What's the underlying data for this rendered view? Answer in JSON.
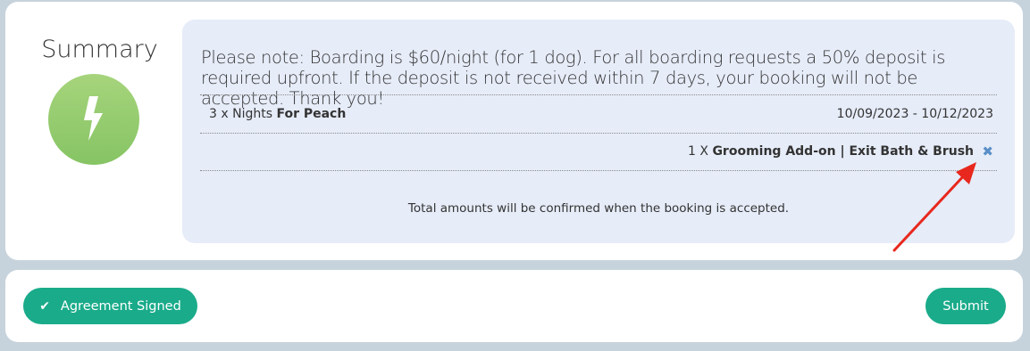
{
  "summary": {
    "title": "Summary",
    "icon": "lightning-bolt-icon",
    "icon_color": "#95cc6f"
  },
  "booking": {
    "note": "Please note: Boarding is $60/night (for 1 dog). For all boarding requests a 50% deposit is required upfront. If the deposit is not received within 7 days, your booking will not be accepted. Thank you!",
    "nights_prefix": "3 x Nights",
    "pet_label": "For Peach",
    "dates": "10/09/2023 - 10/12/2023",
    "addon_prefix": "1 X",
    "addon_name": "Grooming Add-on | Exit Bath & Brush",
    "remove_icon": "close-icon",
    "total_note": "Total amounts will be confirmed when the booking is accepted."
  },
  "footer": {
    "agreement_label": "Agreement Signed",
    "agreement_icon": "checkmark-icon",
    "submit_label": "Submit",
    "accent": "#1aab8a"
  },
  "annotation": {
    "arrow_color": "#e8281e"
  }
}
